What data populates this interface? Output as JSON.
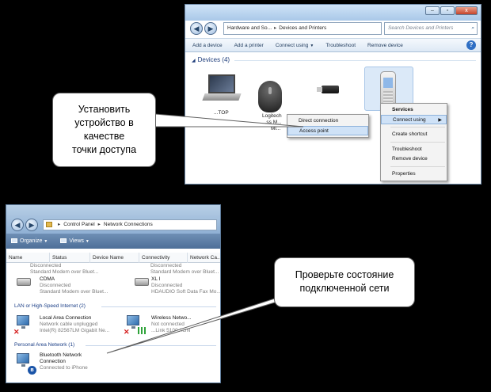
{
  "devices_window": {
    "address": {
      "root": "Hardware and So...",
      "current": "Devices and Printers"
    },
    "window_buttons": {
      "minimize": "–",
      "maximize": "▫",
      "close": "x"
    },
    "nav": {
      "back": "◀",
      "forward": "▶",
      "refresh": "⟳"
    },
    "search_placeholder": "Search Devices and Printers",
    "toolbar": [
      {
        "label": "Add a device"
      },
      {
        "label": "Add a printer"
      },
      {
        "label": "Connect using",
        "dropdown": true
      },
      {
        "label": "Troubleshoot"
      },
      {
        "label": "Remove device"
      }
    ],
    "help": "?",
    "group_label": "Devices (4)",
    "devices": [
      {
        "label": "...TOP",
        "icon": "laptop-icon"
      },
      {
        "label_line1": "Logitech",
        "label_line2": "...ss M...",
        "label_line3": "Mi...",
        "icon": "mouse-icon"
      },
      {
        "label": "",
        "icon": "usb-dongle-icon"
      },
      {
        "label": "",
        "icon": "phone-icon",
        "selected": true
      }
    ],
    "context_menu": {
      "items": [
        {
          "label": "Services",
          "bold": true
        },
        {
          "label": "Connect using",
          "submenu": true,
          "highlighted": true
        },
        {
          "label": "Create shortcut"
        },
        {
          "label": "Troubleshoot"
        },
        {
          "label": "Remove device"
        },
        {
          "label": "Properties"
        }
      ]
    },
    "submenu": {
      "items": [
        {
          "label": "Direct connection"
        },
        {
          "label": "Access point",
          "highlighted": true
        }
      ]
    }
  },
  "callout_top": {
    "lines": [
      "Установить",
      "устройство в",
      "качестве",
      "точки доступа"
    ]
  },
  "network_window": {
    "address": {
      "root": "Control Panel",
      "current": "Network Connections"
    },
    "toolbar": {
      "organize": "Organize",
      "views": "Views"
    },
    "columns": [
      "Name",
      "Status",
      "Device Name",
      "Connectivity",
      "Network Ca..."
    ],
    "items_top": [
      {
        "name": "Disconnected",
        "sub": "Standard Modem over Bluet..."
      },
      {
        "name": "Disconnected",
        "sub": "Standard Modem over Bluet..."
      }
    ],
    "modems": [
      {
        "name": "CDMA",
        "status": "Disconnected",
        "sub": "Standard Modem over Bluet..."
      },
      {
        "name": "XL I",
        "status": "Disconnected",
        "sub": "HDAUDIO Soft Data Fax Mo..."
      }
    ],
    "section_lan": "LAN or High-Speed Internet (2)",
    "lan": [
      {
        "name": "Local Area Connection",
        "status": "Network cable unplugged",
        "sub": "Intel(R) 82567LM Gigabit Ne..."
      },
      {
        "name": "Wireless Netwo...",
        "status": "Not connected",
        "sub": "...Link 5100 AGN"
      }
    ],
    "section_pan": "Personal Area Network (1)",
    "pan": [
      {
        "name_line1": "Bluetooth Network",
        "name_line2": "Connection",
        "status": "Connected to iPhone"
      }
    ]
  },
  "callout_bottom": {
    "lines": [
      "Проверьте состояние",
      "подключенной сети"
    ]
  },
  "colors": {
    "background": "#000000",
    "callout_fill": "#ffffff",
    "menu_highlight": "#cfe2f7",
    "error_red": "#d41b1b",
    "section_blue": "#1a3e86"
  }
}
